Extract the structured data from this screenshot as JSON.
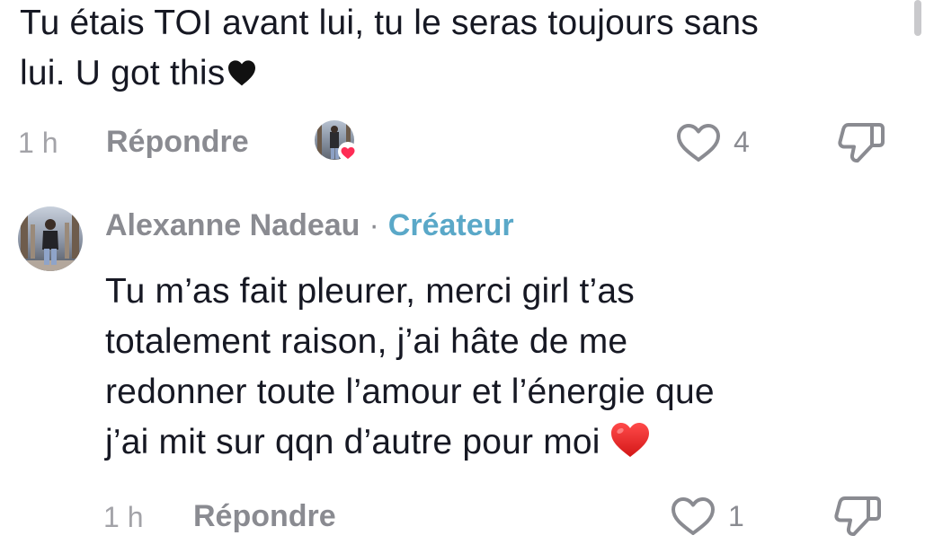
{
  "comment1": {
    "lines": [
      "Tu étais TOI avant lui, tu le seras toujours sans",
      "lui. U got this"
    ],
    "time": "1 h",
    "reply_label": "Répondre",
    "likes": "4"
  },
  "comment2": {
    "author": "Alexanne Nadeau",
    "separator": "·",
    "badge": "Créateur",
    "lines": [
      "Tu m’as fait pleurer, merci girl t’as",
      "totalement raison, j’ai hâte de me",
      "redonner toute l’amour et l’énergie que",
      "j’ai mit sur qqn d’autre pour moi"
    ],
    "time": "1 h",
    "reply_label": "Répondre",
    "likes": "1"
  },
  "icons": {
    "black_heart": "black-heart-icon",
    "red_heart": "red-heart-emoji",
    "like": "heart-outline-icon",
    "dislike": "thumbs-down-icon"
  },
  "colors": {
    "text": "#161823",
    "muted": "#8a8b91",
    "time": "#a3a3a8",
    "creator_badge": "#5aa8c8",
    "liked_heart": "#fe2c55"
  }
}
